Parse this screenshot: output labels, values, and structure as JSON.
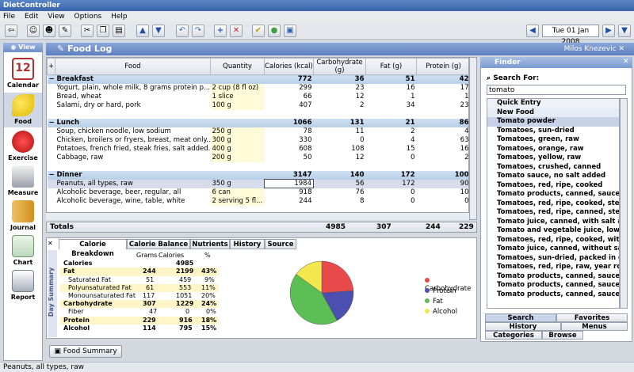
{
  "window": {
    "title": "DietController"
  },
  "menu": [
    "File",
    "Edit",
    "View",
    "Options",
    "Help"
  ],
  "toolbar": {
    "date": "Tue 01 Jan 2008"
  },
  "sidebar": {
    "view_label": "View",
    "items": [
      {
        "label": "Calendar",
        "icon": "calendar-icon",
        "active": false
      },
      {
        "label": "Food",
        "icon": "banana-icon",
        "active": true
      },
      {
        "label": "Exercise",
        "icon": "boxing-glove-icon",
        "active": false
      },
      {
        "label": "Measure",
        "icon": "scale-icon",
        "active": false
      },
      {
        "label": "Journal",
        "icon": "journal-icon",
        "active": false
      },
      {
        "label": "Chart",
        "icon": "chart-icon",
        "active": false
      },
      {
        "label": "Report",
        "icon": "printer-icon",
        "active": false
      }
    ]
  },
  "header": {
    "title": "Food Log",
    "user": "Milos Knezevic"
  },
  "table": {
    "columns": [
      "Food",
      "Quantity",
      "Calories (kcal)",
      "Carbohydrate (g)",
      "Fat (g)",
      "Protein (g)"
    ],
    "groups": [
      {
        "name": "Breakfast",
        "calories": "772",
        "carb": "36",
        "fat": "51",
        "protein": "42",
        "rows": [
          {
            "food": "Yogurt, plain, whole milk, 8 grams protein p...",
            "qty": "2 cup (8 fl oz)",
            "cal": "299",
            "carb": "23",
            "fat": "16",
            "protein": "17"
          },
          {
            "food": "Bread, wheat",
            "qty": "1 slice",
            "cal": "66",
            "carb": "12",
            "fat": "1",
            "protein": "1"
          },
          {
            "food": "Salami, dry or hard, pork",
            "qty": "100 g",
            "cal": "407",
            "carb": "2",
            "fat": "34",
            "protein": "23"
          }
        ]
      },
      {
        "name": "Lunch",
        "calories": "1066",
        "carb": "131",
        "fat": "21",
        "protein": "86",
        "rows": [
          {
            "food": "Soup, chicken noodle, low sodium",
            "qty": "250 g",
            "cal": "78",
            "carb": "11",
            "fat": "2",
            "protein": "4"
          },
          {
            "food": "Chicken, broilers or fryers, breast, meat only...",
            "qty": "300 g",
            "cal": "330",
            "carb": "0",
            "fat": "4",
            "protein": "63"
          },
          {
            "food": "Potatoes, french fried, steak fries, salt added...",
            "qty": "400 g",
            "cal": "608",
            "carb": "108",
            "fat": "15",
            "protein": "16"
          },
          {
            "food": "Cabbage, raw",
            "qty": "200 g",
            "cal": "50",
            "carb": "12",
            "fat": "0",
            "protein": "2"
          }
        ]
      },
      {
        "name": "Dinner",
        "calories": "3147",
        "carb": "140",
        "fat": "172",
        "protein": "100",
        "rows": [
          {
            "food": "Peanuts, all types, raw",
            "qty": "350 g",
            "cal": "1984",
            "carb": "56",
            "fat": "172",
            "protein": "90"
          },
          {
            "food": "Alcoholic beverage, beer, regular, all",
            "qty": "6 can",
            "cal": "918",
            "carb": "76",
            "fat": "0",
            "protein": "10"
          },
          {
            "food": "Alcoholic beverage, wine, table, white",
            "qty": "2 serving 5 fl...",
            "cal": "244",
            "carb": "8",
            "fat": "0",
            "protein": "0"
          }
        ]
      }
    ],
    "totals": {
      "label": "Totals",
      "cal": "4985",
      "carb": "307",
      "fat": "244",
      "protein": "229"
    }
  },
  "finder": {
    "title": "Finder",
    "search_label": "Search For:",
    "search_value": "tomato",
    "results": [
      "Quick Entry",
      "New Food",
      "Tomato powder",
      "Tomatoes, sun-dried",
      "Tomatoes, green, raw",
      "Tomatoes, orange, raw",
      "Tomatoes, yellow, raw",
      "Tomatoes, crushed, canned",
      "Tomato sauce, no salt added",
      "Tomatoes, red, ripe, cooked",
      "Tomato products, canned, sauce",
      "Tomatoes, red, ripe, cooked, stewed",
      "Tomatoes, red, ripe, canned, stewed",
      "Tomato juice, canned, with salt adde",
      "Tomato and vegetable juice, low sod",
      "Tomatoes, red, ripe, cooked, with sal",
      "Tomato juice, canned, without salt a",
      "Tomatoes, sun-dried, packed in oil, c",
      "Tomatoes, red, ripe, raw, year round a",
      "Tomato products, canned, sauce, with",
      "Tomato products, canned, sauce, spa",
      "Tomato products, canned, sauce, with"
    ],
    "tabs": [
      "Search",
      "Favorites",
      "History",
      "Menus",
      "Categories",
      "Browse"
    ]
  },
  "bottom": {
    "tabs": [
      "Calorie Breakdown",
      "Calorie Balance",
      "Nutrients",
      "History",
      "Source"
    ],
    "side_label": "Day Summary",
    "headers": {
      "grams": "Grams",
      "calories": "Calories",
      "pct": "%"
    },
    "rows": [
      {
        "name": "Calories",
        "g": "",
        "cal": "4985",
        "pct": "",
        "bold": true
      },
      {
        "name": "Fat",
        "g": "244",
        "cal": "2199",
        "pct": "43%",
        "bold": true
      },
      {
        "name": "Saturated Fat",
        "g": "51",
        "cal": "459",
        "pct": "9%",
        "bold": false
      },
      {
        "name": "Polyunsaturated Fat",
        "g": "61",
        "cal": "553",
        "pct": "11%",
        "bold": false
      },
      {
        "name": "Monounsaturated Fat",
        "g": "117",
        "cal": "1051",
        "pct": "20%",
        "bold": false
      },
      {
        "name": "Carbohydrate",
        "g": "307",
        "cal": "1229",
        "pct": "24%",
        "bold": true
      },
      {
        "name": "Fiber",
        "g": "47",
        "cal": "0",
        "pct": "0%",
        "bold": false
      },
      {
        "name": "Protein",
        "g": "229",
        "cal": "916",
        "pct": "18%",
        "bold": true
      },
      {
        "name": "Alcohol",
        "g": "114",
        "cal": "795",
        "pct": "15%",
        "bold": true
      }
    ],
    "food_summary_button": "Food Summary"
  },
  "chart_data": {
    "type": "pie",
    "categories": [
      "Carbohydrate",
      "Protein",
      "Fat",
      "Alcohol"
    ],
    "values": [
      24,
      18,
      43,
      15
    ],
    "colors": [
      "#e84a4a",
      "#4b4fb0",
      "#5cbf56",
      "#f2e84e"
    ],
    "legend": "right"
  },
  "status": {
    "text": "Peanuts, all types, raw"
  }
}
